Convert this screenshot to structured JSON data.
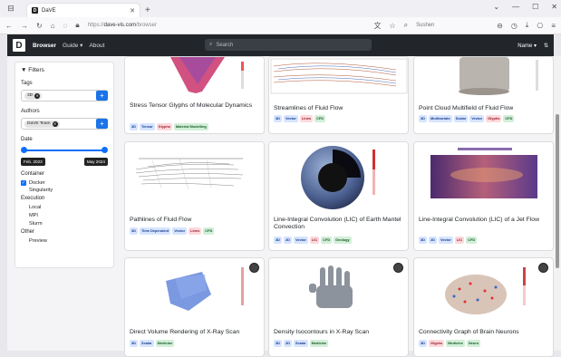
{
  "browser": {
    "tab_title": "DaVE",
    "url_prefix": "https://",
    "url_domain": "dave-vis.com",
    "url_path": "/browser",
    "toolbar_search_label": "Sushen"
  },
  "nav": {
    "logo": "D",
    "browser": "Browser",
    "guide": "Guide ▾",
    "about": "About",
    "search_placeholder": "Search",
    "name": "Name ▾",
    "sort": "⇅"
  },
  "filters": {
    "header": "▼ Filters",
    "tags_label": "Tags",
    "tag_chip": "3D",
    "authors_label": "Authors",
    "author_chip": "DaVE Team",
    "date_label": "Date",
    "date_from": "Feb. 2023",
    "date_to": "May 2024",
    "container_label": "Container",
    "docker": "Docker",
    "singularity": "Singularity",
    "execution_label": "Execution",
    "local": "Local",
    "mpi": "MPI",
    "slurm": "Slurm",
    "other_label": "Other",
    "preview": "Preview"
  },
  "cards": [
    {
      "title": "Stress Tensor Glyphs of Molecular Dynamics",
      "tags": [
        {
          "t": "3D",
          "c": "blue"
        },
        {
          "t": "Tensor",
          "c": "blue"
        },
        {
          "t": "Glyphs",
          "c": "red"
        },
        {
          "t": "Material Modelling",
          "c": "green"
        }
      ]
    },
    {
      "title": "Streamlines of Fluid Flow",
      "tags": [
        {
          "t": "3D",
          "c": "blue"
        },
        {
          "t": "Vector",
          "c": "blue"
        },
        {
          "t": "Lines",
          "c": "red"
        },
        {
          "t": "CFD",
          "c": "green"
        }
      ]
    },
    {
      "title": "Point Cloud Multifield of Fluid Flow",
      "tags": [
        {
          "t": "3D",
          "c": "blue"
        },
        {
          "t": "Multivariate",
          "c": "blue"
        },
        {
          "t": "Scalar",
          "c": "blue"
        },
        {
          "t": "Vector",
          "c": "blue"
        },
        {
          "t": "Glyphs",
          "c": "red"
        },
        {
          "t": "CFD",
          "c": "green"
        }
      ]
    },
    {
      "title": "Pathlines of Fluid Flow",
      "tags": [
        {
          "t": "3D",
          "c": "blue"
        },
        {
          "t": "Time Dependent",
          "c": "blue"
        },
        {
          "t": "Vector",
          "c": "blue"
        },
        {
          "t": "Lines",
          "c": "red"
        },
        {
          "t": "CFD",
          "c": "green"
        }
      ]
    },
    {
      "title": "Line-Integral Convolution (LIC) of Earth Mantel Convection",
      "tags": [
        {
          "t": "3D",
          "c": "blue"
        },
        {
          "t": "2D",
          "c": "blue"
        },
        {
          "t": "Vector",
          "c": "blue"
        },
        {
          "t": "LIC",
          "c": "red"
        },
        {
          "t": "CFD",
          "c": "green"
        },
        {
          "t": "Geology",
          "c": "green"
        }
      ]
    },
    {
      "title": "Line-Integral Convolution (LIC) of a Jet Flow",
      "tags": [
        {
          "t": "3D",
          "c": "blue"
        },
        {
          "t": "2D",
          "c": "blue"
        },
        {
          "t": "Vector",
          "c": "blue"
        },
        {
          "t": "LIC",
          "c": "red"
        },
        {
          "t": "CFD",
          "c": "green"
        }
      ]
    },
    {
      "title": "Direct Volume Rendering of X-Ray Scan",
      "tags": [
        {
          "t": "3D",
          "c": "blue"
        },
        {
          "t": "Scalar",
          "c": "blue"
        },
        {
          "t": "Medicine",
          "c": "green"
        }
      ]
    },
    {
      "title": "Density Isocontours in X-Ray Scan",
      "tags": [
        {
          "t": "3D",
          "c": "blue"
        },
        {
          "t": "2D",
          "c": "blue"
        },
        {
          "t": "Scalar",
          "c": "blue"
        },
        {
          "t": "Medicine",
          "c": "green"
        }
      ]
    },
    {
      "title": "Connectivity Graph of Brain Neurons",
      "tags": [
        {
          "t": "3D",
          "c": "blue"
        },
        {
          "t": "Glyphs",
          "c": "red"
        },
        {
          "t": "Medicine",
          "c": "green"
        },
        {
          "t": "Neuro",
          "c": "green"
        }
      ]
    }
  ]
}
